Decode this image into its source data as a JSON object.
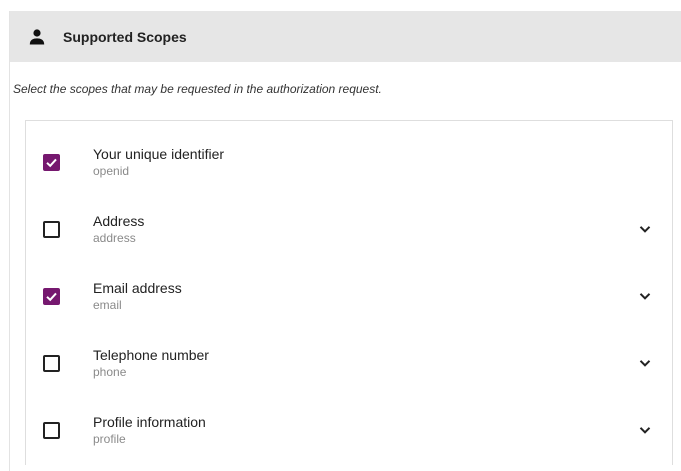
{
  "header": {
    "title": "Supported Scopes",
    "icon": "person-icon"
  },
  "description": "Select the scopes that may be requested in the authorization request.",
  "colors": {
    "accent": "#76186f",
    "header_bg": "#e6e6e6"
  },
  "scopes": [
    {
      "label": "Your unique identifier",
      "key": "openid",
      "checked": true,
      "expandable": false
    },
    {
      "label": "Address",
      "key": "address",
      "checked": false,
      "expandable": true
    },
    {
      "label": "Email address",
      "key": "email",
      "checked": true,
      "expandable": true
    },
    {
      "label": "Telephone number",
      "key": "phone",
      "checked": false,
      "expandable": true
    },
    {
      "label": "Profile information",
      "key": "profile",
      "checked": false,
      "expandable": true
    }
  ]
}
